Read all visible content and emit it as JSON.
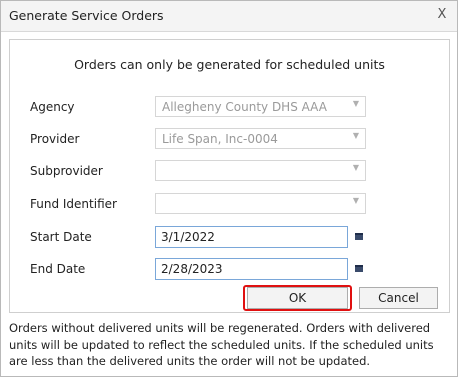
{
  "dialog": {
    "title": "Generate Service Orders",
    "close_label": "X",
    "notice": "Orders can only be generated for scheduled units"
  },
  "form": {
    "agency": {
      "label": "Agency",
      "value": "Allegheny County DHS AAA"
    },
    "provider": {
      "label": "Provider",
      "value": "Life Span, Inc-0004"
    },
    "subprovider": {
      "label": "Subprovider",
      "value": ""
    },
    "fund_identifier": {
      "label": "Fund Identifier",
      "value": ""
    },
    "start_date": {
      "label": "Start Date",
      "value": "3/1/2022"
    },
    "end_date": {
      "label": "End Date",
      "value": "2/28/2023"
    }
  },
  "buttons": {
    "ok": "OK",
    "cancel": "Cancel"
  },
  "footer_text": "Orders without delivered units will be regenerated.  Orders with delivered units will be updated to reflect the scheduled units. If the scheduled units are less than the delivered units the order will not be updated.",
  "colors": {
    "highlight": "#e01010",
    "input_border": "#7aa7d9"
  }
}
